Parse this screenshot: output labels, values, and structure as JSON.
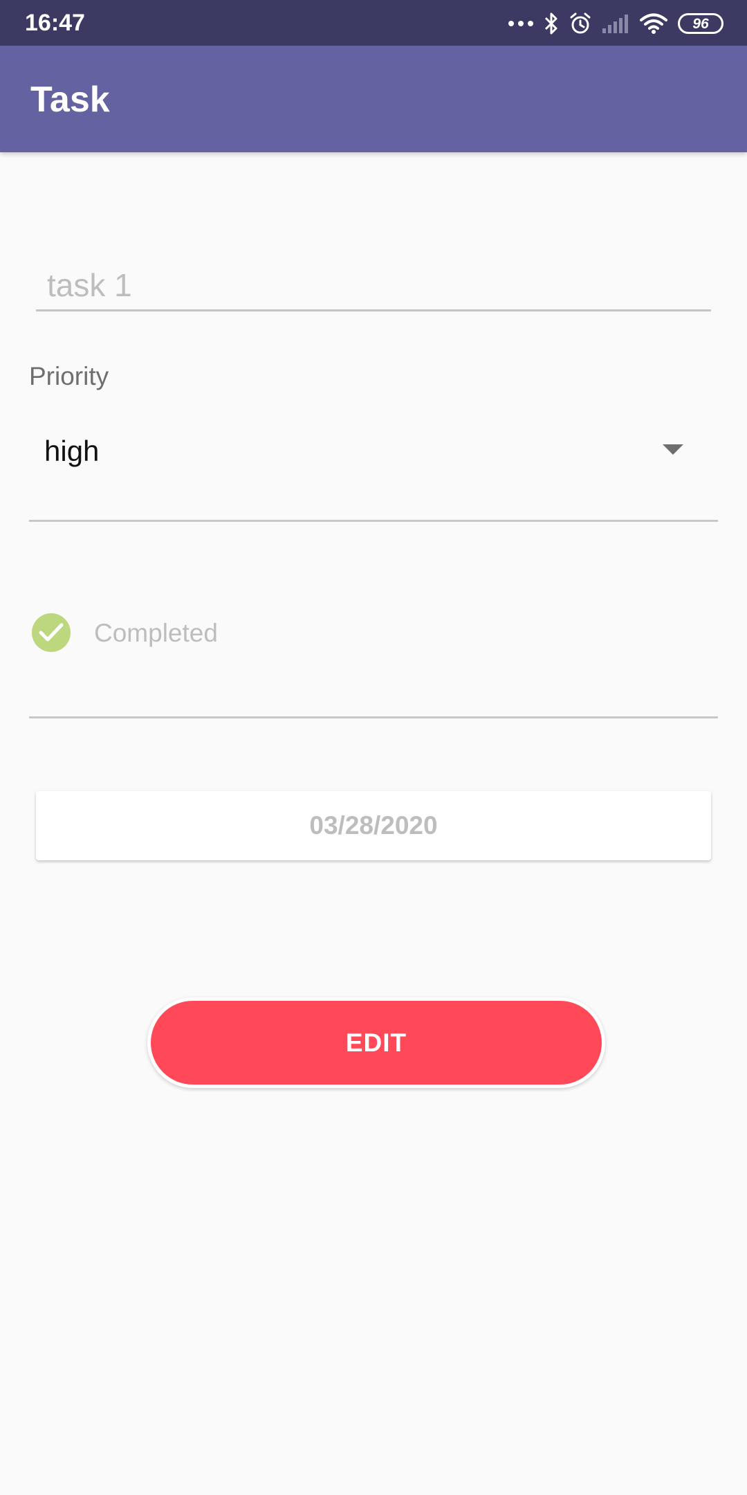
{
  "status_bar": {
    "time": "16:47",
    "battery_level": "96",
    "icons": [
      "more-dots-icon",
      "bluetooth-icon",
      "alarm-icon",
      "signal-icon",
      "wifi-icon",
      "battery-icon"
    ]
  },
  "app_bar": {
    "title": "Task",
    "color": "#6462a0"
  },
  "form": {
    "task_name": "task 1",
    "priority_label": "Priority",
    "priority_value": "high",
    "completed_label": "Completed",
    "completed_checked": true,
    "date_value": "03/28/2020",
    "edit_label": "EDIT"
  },
  "colors": {
    "status_bar": "#3c3a62",
    "accent": "#ff4858",
    "check": "#bcd77e"
  }
}
